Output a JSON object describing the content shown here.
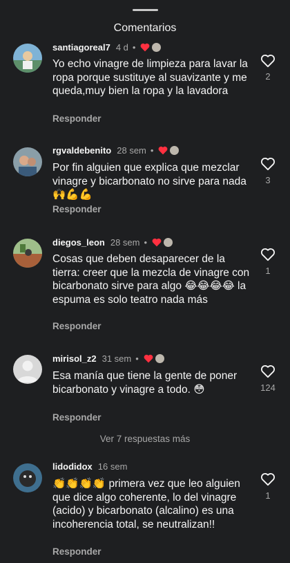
{
  "header": {
    "title": "Comentarios"
  },
  "comments": [
    {
      "username": "santiagoreal7",
      "time": "4 d",
      "dot": "•",
      "text": "Yo echo vinagre de limpieza para lavar la ropa porque sustituye al suavizante y me queda,muy bien la ropa y la lavadora",
      "reply": "Responder",
      "likes": "2"
    },
    {
      "username": "rgvaldebenito",
      "time": "28 sem",
      "dot": "•",
      "text": "Por fin alguien que explica que mezclar vinagre y bicarbonato no sirve para nada 🙌💪💪",
      "reply": "Responder",
      "likes": "3"
    },
    {
      "username": "diegos_leon",
      "time": "28 sem",
      "dot": "•",
      "text": "Cosas que deben desaparecer de la tierra: creer que la mezcla de vinagre con bicarbonato sirve para algo 😂😂😂😂 la espuma es solo teatro nada más",
      "reply": "Responder",
      "likes": "1"
    },
    {
      "username": "mirisol_z2",
      "time": "31 sem",
      "dot": "•",
      "text": "Esa manía que tiene la gente de poner bicarbonato y vinagre a todo. 😳",
      "reply": "Responder",
      "likes": "124"
    },
    {
      "username": "lidodidox",
      "time": "16 sem",
      "dot": "",
      "text": "👏👏👏👏 primera vez que leo alguien que dice algo coherente, lo del vinagre (acido) y bicarbonato (alcalino) es una incoherencia total, se neutralizan!!",
      "reply": "Responder",
      "likes": "1"
    }
  ],
  "view_more": "Ver 7 respuestas más",
  "colors": {
    "background": "#1e1f21",
    "heart_red": "#ff3040",
    "secondary_text": "#a8a8a8"
  }
}
